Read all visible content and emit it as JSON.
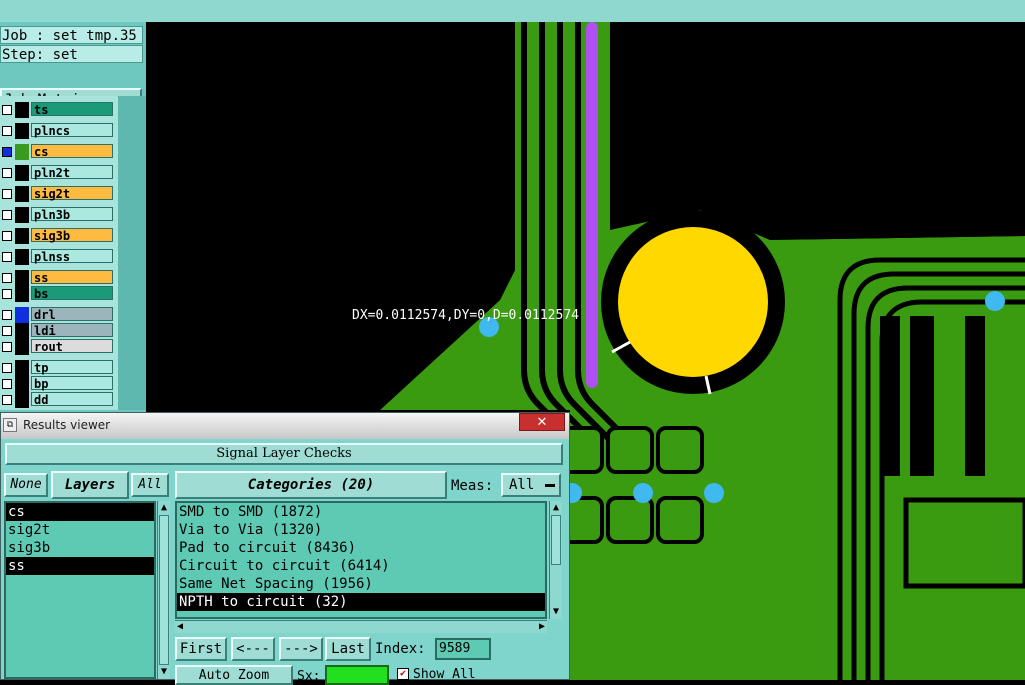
{
  "left_panel": {
    "job": "Job : set_tmp.35",
    "step": "Step: set",
    "job_matrix_button": "Job Matrix ...",
    "layers": [
      {
        "name": "ts",
        "bg": "#1a9a78",
        "swatch": "#000000"
      },
      {
        "name": "plncs",
        "bg": "#aae8e0",
        "swatch": "#000000"
      },
      {
        "name": "cs",
        "bg": "#ffba40",
        "swatch": "#3a9a20",
        "selected": true
      },
      {
        "name": "pln2t",
        "bg": "#aae8e0",
        "swatch": "#000000"
      },
      {
        "name": "sig2t",
        "bg": "#ffba40",
        "swatch": "#000000"
      },
      {
        "name": "pln3b",
        "bg": "#aae8e0",
        "swatch": "#000000"
      },
      {
        "name": "sig3b",
        "bg": "#ffba40",
        "swatch": "#000000"
      },
      {
        "name": "plnss",
        "bg": "#aae8e0",
        "swatch": "#000000"
      },
      {
        "name": "ss",
        "bg": "#ffba40",
        "swatch": "#000000"
      },
      {
        "name": "bs",
        "bg": "#1a9a78",
        "swatch": "#000000"
      },
      {
        "name": "drl",
        "bg": "#9cb4bc",
        "swatch": "#1030e0"
      },
      {
        "name": "ldi",
        "bg": "#9cb4bc",
        "swatch": "#000000"
      },
      {
        "name": "rout",
        "bg": "#dcdcdc",
        "swatch": "#000000"
      },
      {
        "name": "tp",
        "bg": "#aae8e0",
        "swatch": "#000000"
      },
      {
        "name": "bp",
        "bg": "#aae8e0",
        "swatch": "#000000"
      },
      {
        "name": "dd",
        "bg": "#aae8e0",
        "swatch": "#000000"
      }
    ]
  },
  "canvas": {
    "measure_text": "DX=0.0112574,DY=0,D=0.0112574",
    "colors": {
      "copper": "#3a9a10",
      "highlight_pad": "#ffd800",
      "drill": "#40b8f0",
      "trace_selected": "#b050f0"
    }
  },
  "results_viewer": {
    "title": "Results viewer",
    "close": "✕",
    "header": "Signal Layer Checks",
    "none_button": "None",
    "layers_label": "Layers",
    "all_button": "All",
    "categories_label": "Categories (20)",
    "meas_label": "Meas:",
    "meas_value": "All",
    "layer_items": [
      {
        "label": "cs",
        "selected": true
      },
      {
        "label": "sig2t",
        "selected": false
      },
      {
        "label": "sig3b",
        "selected": false
      },
      {
        "label": "ss",
        "selected": true
      }
    ],
    "categories": [
      {
        "label": "SMD to SMD (1872)",
        "selected": false
      },
      {
        "label": "Via to Via (1320)",
        "selected": false
      },
      {
        "label": "Pad to circuit (8436)",
        "selected": false
      },
      {
        "label": "Circuit to circuit (6414)",
        "selected": false
      },
      {
        "label": "Same Net Spacing (1956)",
        "selected": false
      },
      {
        "label": "NPTH to circuit (32)",
        "selected": true
      }
    ],
    "nav": {
      "first": "First",
      "prev": "<---",
      "next": "--->",
      "last": "Last",
      "index_label": "Index:",
      "index_value": "9589"
    },
    "bottom": {
      "auto_zoom": "Auto Zoom",
      "sx_label": "Sx:",
      "show_all": "Show All"
    }
  }
}
